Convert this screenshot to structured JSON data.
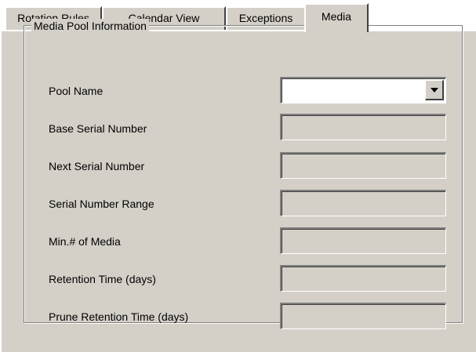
{
  "tabs": [
    {
      "label": "Rotation Rules",
      "active": false
    },
    {
      "label": "Calendar View",
      "active": false
    },
    {
      "label": "Exceptions",
      "active": false
    },
    {
      "label": "Media",
      "active": true
    }
  ],
  "group": {
    "title": "Media Pool Information",
    "fields": [
      {
        "label": "Pool Name",
        "type": "dropdown",
        "value": ""
      },
      {
        "label": "Base Serial Number",
        "type": "text-disabled",
        "value": ""
      },
      {
        "label": "Next Serial Number",
        "type": "text-disabled",
        "value": ""
      },
      {
        "label": "Serial Number Range",
        "type": "text-disabled",
        "value": ""
      },
      {
        "label": "Min.# of Media",
        "type": "text-disabled",
        "value": ""
      },
      {
        "label": "Retention Time (days)",
        "type": "text-disabled",
        "value": ""
      },
      {
        "label": "Prune Retention Time (days)",
        "type": "text-disabled",
        "value": ""
      }
    ]
  },
  "icons": {
    "dropdown": "chevron-down-icon"
  },
  "colors": {
    "face": "#d4d0c8",
    "highlight": "#ffffff",
    "shadow": "#808080",
    "dark": "#404040"
  }
}
